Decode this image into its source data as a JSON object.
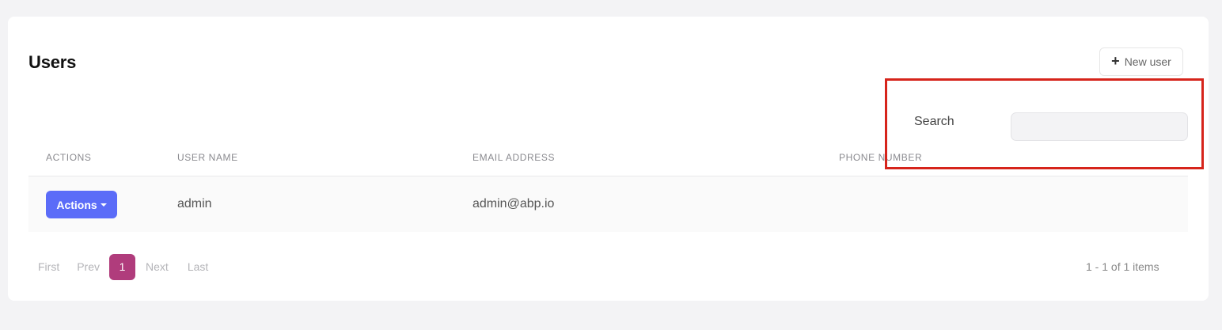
{
  "page": {
    "title": "Users",
    "new_user_label": "New user",
    "new_user_icon": "plus-icon"
  },
  "search": {
    "label": "Search",
    "value": "",
    "placeholder": ""
  },
  "table": {
    "columns": [
      "ACTIONS",
      "USER NAME",
      "EMAIL ADDRESS",
      "PHONE NUMBER"
    ],
    "rows": [
      {
        "actions_label": "Actions",
        "user_name": "admin",
        "email": "admin@abp.io",
        "phone": ""
      }
    ]
  },
  "pagination": {
    "first": "First",
    "prev": "Prev",
    "current": "1",
    "next": "Next",
    "last": "Last",
    "summary": "1 - 1 of 1 items"
  },
  "colors": {
    "accent_actions": "#5b6cf8",
    "accent_page": "#b03c7c",
    "highlight": "#d6241b"
  }
}
